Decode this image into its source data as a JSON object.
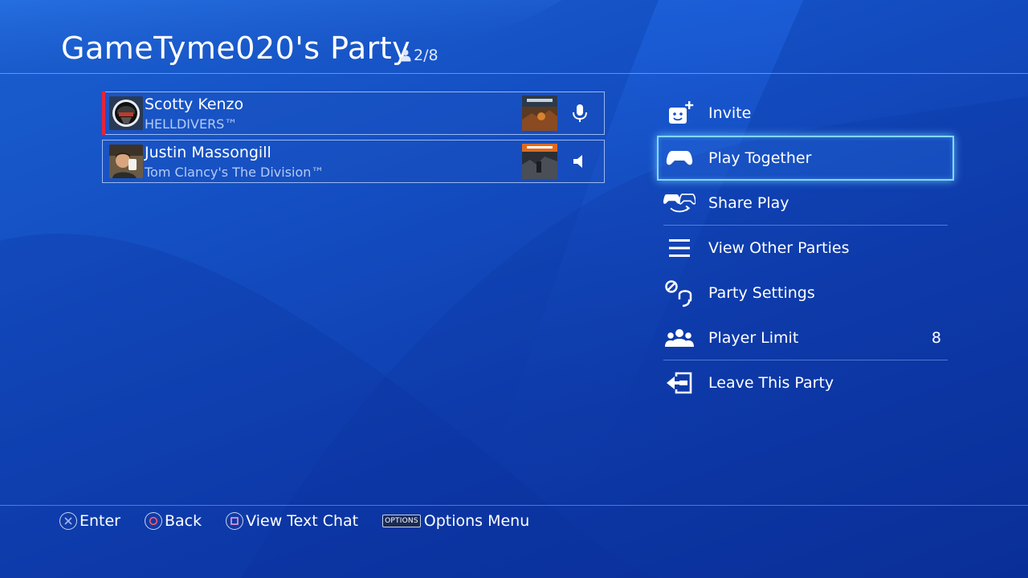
{
  "header": {
    "title": "GameTyme020's Party",
    "member_count": "2/8"
  },
  "members": [
    {
      "name": "Scotty Kenzo",
      "game": "HELLDIVERS™",
      "voice_icon": "microphone-icon",
      "is_host": true
    },
    {
      "name": "Justin Massongill",
      "game": "Tom Clancy's The Division™",
      "voice_icon": "speaker-icon",
      "is_host": false
    }
  ],
  "menu": {
    "items": [
      {
        "label": "Invite",
        "icon": "invite-icon"
      },
      {
        "label": "Play Together",
        "icon": "controller-icon",
        "selected": true
      },
      {
        "label": "Share Play",
        "icon": "share-play-icon"
      },
      {
        "label": "View Other Parties",
        "icon": "list-icon"
      },
      {
        "label": "Party Settings",
        "icon": "settings-icon"
      },
      {
        "label": "Player Limit",
        "icon": "players-icon",
        "value": "8"
      },
      {
        "label": "Leave This Party",
        "icon": "leave-icon"
      }
    ]
  },
  "footer": {
    "enter": "Enter",
    "back": "Back",
    "text_chat": "View Text Chat",
    "options_key": "OPTIONS",
    "options": "Options Menu"
  },
  "colors": {
    "accent_highlight": "#7fd8ff",
    "host_marker": "#e8233a",
    "background": "#1450c4"
  }
}
